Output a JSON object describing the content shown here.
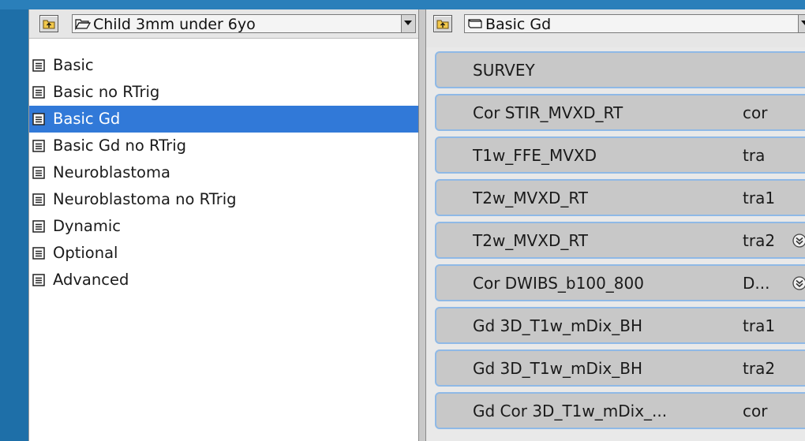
{
  "left_panel": {
    "folder_name": "Child 3mm under 6yo",
    "items": [
      {
        "label": "Basic"
      },
      {
        "label": "Basic no RTrig"
      },
      {
        "label": "Basic Gd"
      },
      {
        "label": "Basic Gd no RTrig"
      },
      {
        "label": "Neuroblastoma"
      },
      {
        "label": "Neuroblastoma no RTrig"
      },
      {
        "label": "Dynamic"
      },
      {
        "label": "Optional"
      },
      {
        "label": "Advanced"
      }
    ],
    "selected_index": 2
  },
  "right_panel": {
    "exam_name": "Basic Gd",
    "scans": [
      {
        "name": "SURVEY",
        "orientation": "",
        "expand": false
      },
      {
        "name": "Cor STIR_MVXD_RT",
        "orientation": "cor",
        "expand": false
      },
      {
        "name": "T1w_FFE_MVXD",
        "orientation": "tra",
        "expand": false
      },
      {
        "name": "T2w_MVXD_RT",
        "orientation": "tra1",
        "expand": false
      },
      {
        "name": "T2w_MVXD_RT",
        "orientation": "tra2",
        "expand": true
      },
      {
        "name": "Cor DWIBS_b100_800",
        "orientation": "D...",
        "expand": true
      },
      {
        "name": "Gd 3D_T1w_mDix_BH",
        "orientation": "tra1",
        "expand": false
      },
      {
        "name": "Gd 3D_T1w_mDix_BH",
        "orientation": "tra2",
        "expand": false
      },
      {
        "name": "Gd  Cor  3D_T1w_mDix_...",
        "orientation": "cor",
        "expand": false
      }
    ]
  },
  "colors": {
    "background": "#1e6fa8",
    "selection": "#3179d8",
    "card_border": "#8fb9e6",
    "card_fill": "#c8c8c8"
  }
}
